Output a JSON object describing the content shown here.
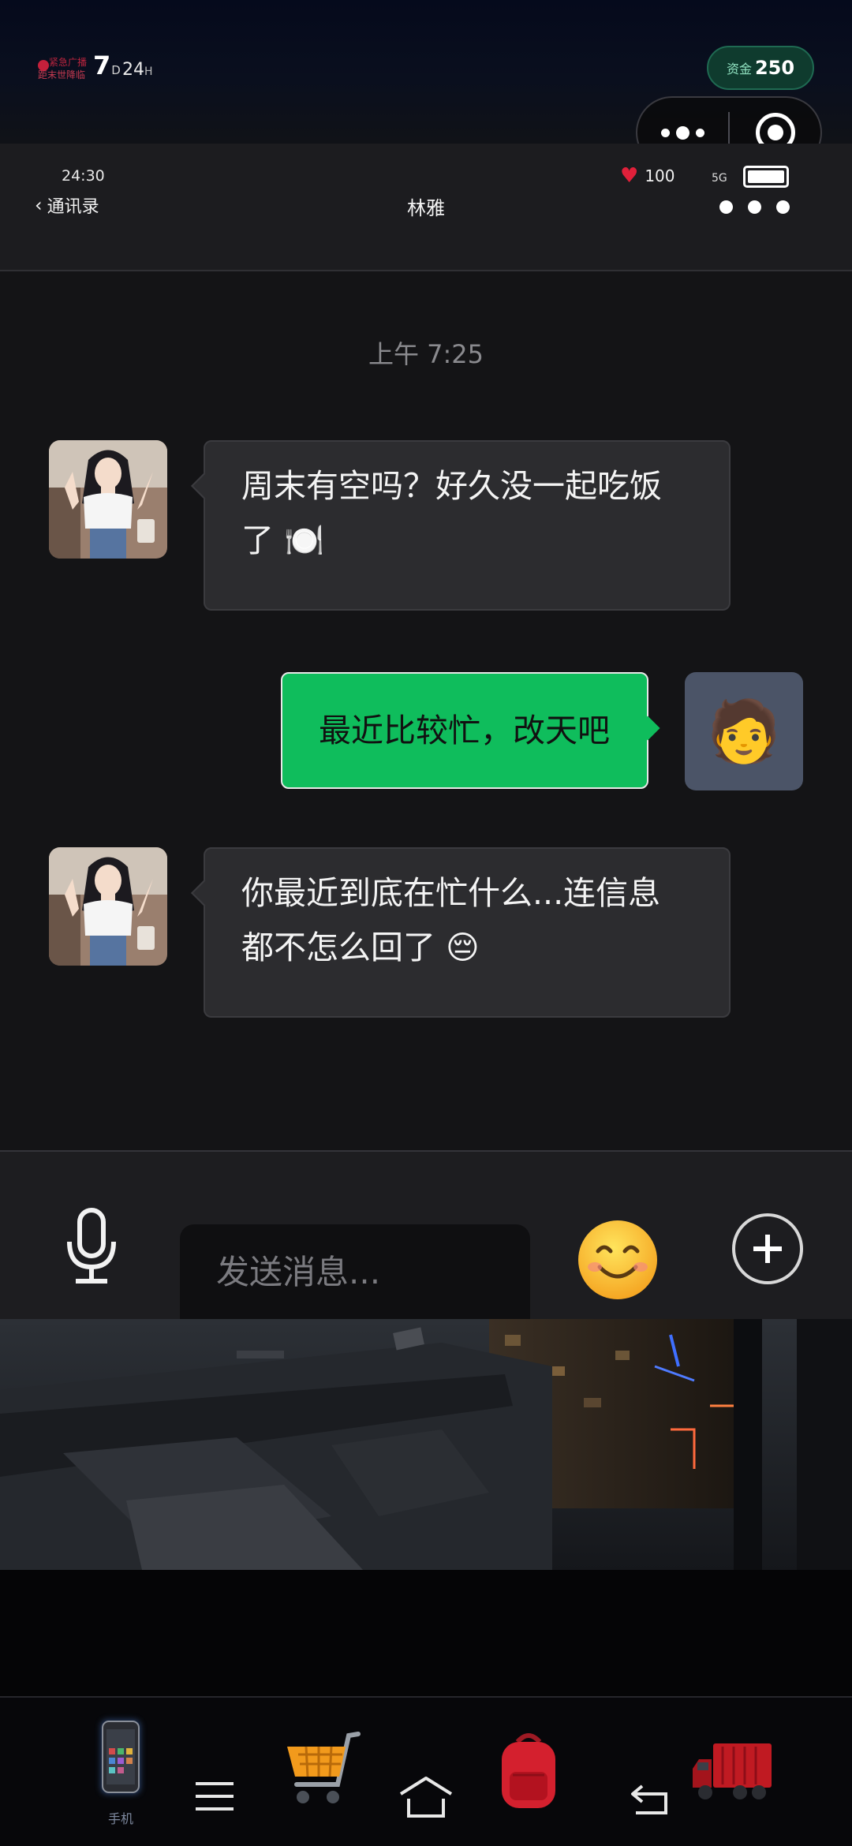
{
  "topbar": {
    "broadcast_line1": "紧急广播",
    "broadcast_line2": "距末世降临",
    "day_value": "7",
    "day_unit": "D",
    "hour_value": "24",
    "hour_unit": "H",
    "funds_label": "资金",
    "funds_value": "250"
  },
  "chat_header": {
    "time": "24:30",
    "heart_value": "100",
    "signal": "5G",
    "back_label": "通讯录",
    "contact_name": "林雅"
  },
  "chat": {
    "timestamp": "上午 7:25",
    "messages": [
      {
        "from": "contact",
        "line1": "周末有空吗？好久没一起吃饭",
        "line2": "了 🍽️"
      },
      {
        "from": "me",
        "text": "最近比较忙，改天吧",
        "avatar_emoji": "🧑"
      },
      {
        "from": "contact",
        "line1": "你最近到底在忙什么...连信息",
        "line2": "都不怎么回了 😔"
      }
    ]
  },
  "input": {
    "placeholder": "发送消息...",
    "emoji_label": "😊"
  },
  "bottom_nav": {
    "phone_label": "手机"
  },
  "colors": {
    "outgoing_bubble": "#0fbd5c",
    "incoming_bubble": "#2c2c2f",
    "funds_badge": "#0f3b2e",
    "heart": "#e0203a"
  }
}
